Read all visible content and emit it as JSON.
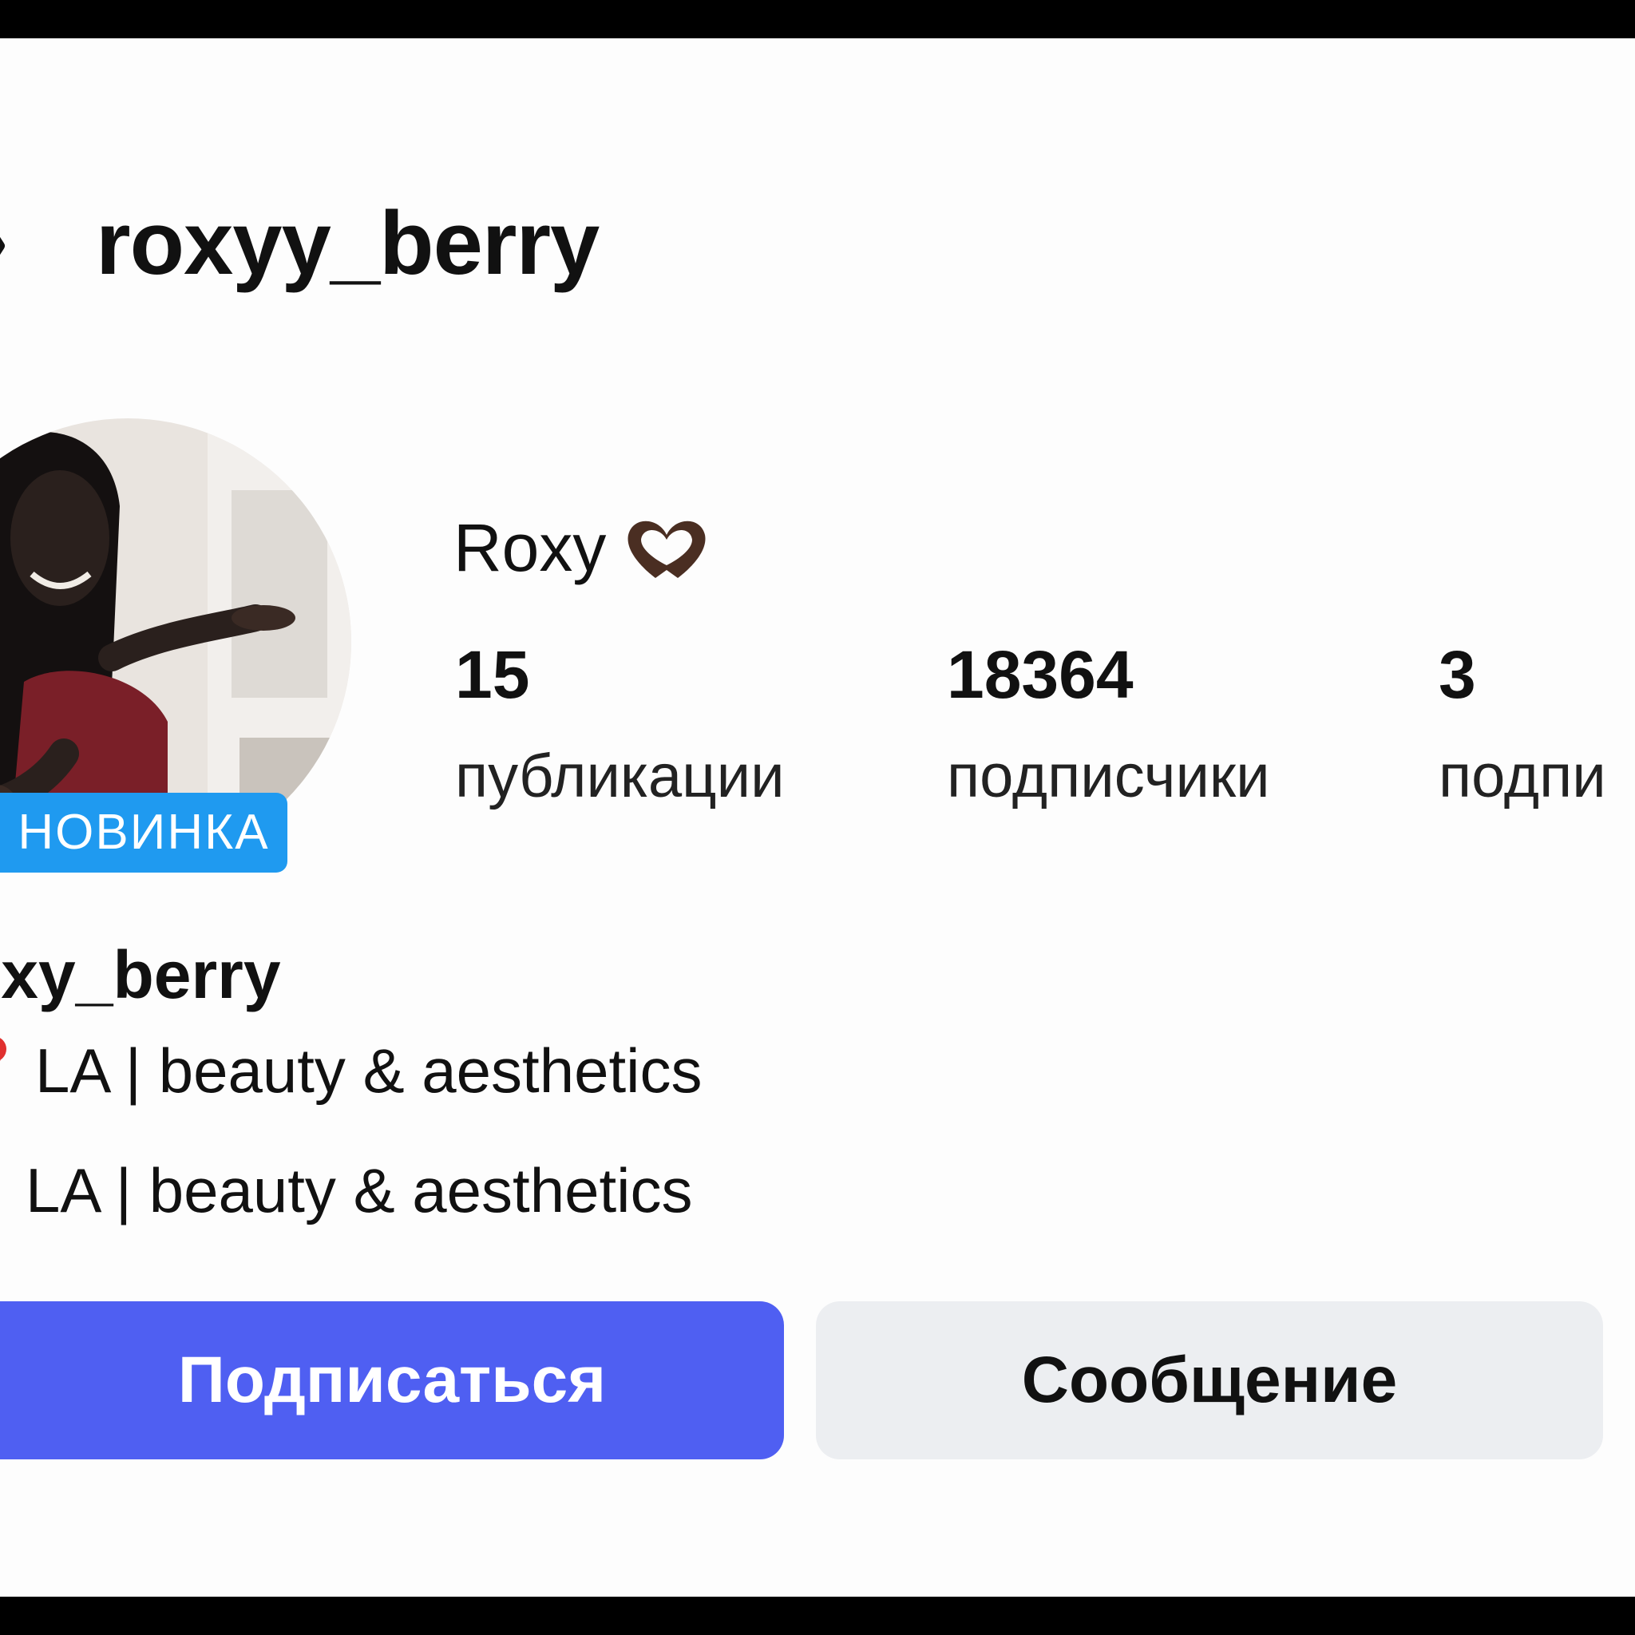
{
  "header": {
    "username": "roxyy_berry"
  },
  "profile": {
    "display_name": "Roxy",
    "badge": "НОВИНКА",
    "bio_username": "oxy_berry",
    "bio_lines": [
      "LA | beauty & aesthetics",
      "LA | beauty & aesthetics"
    ]
  },
  "stats": [
    {
      "value": "15",
      "label": "публикации"
    },
    {
      "value": "18364",
      "label": "подписчики"
    },
    {
      "value": "3",
      "label": "подпи"
    }
  ],
  "actions": {
    "follow_label": "Подписаться",
    "message_label": "Сообщение"
  },
  "colors": {
    "follow_button": "#4f5ff2",
    "message_button": "#eceef1",
    "badge": "#1f9af0",
    "background": "#fdfdfd"
  },
  "icons": {
    "back": "chevron-left-icon",
    "heart_hands": "heart-hands-emoji",
    "location": "map-pin-icon"
  }
}
